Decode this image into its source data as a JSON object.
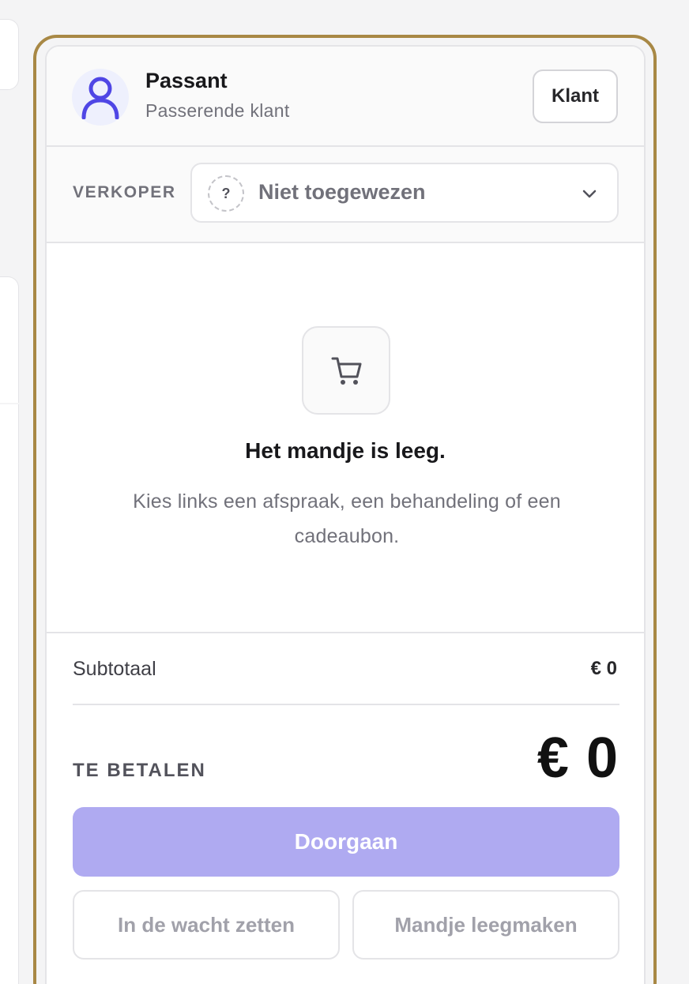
{
  "customer": {
    "name": "Passant",
    "subtitle": "Passerende klant",
    "button_label": "Klant"
  },
  "seller": {
    "label": "VERKOPER",
    "placeholder_symbol": "?",
    "value": "Niet toegewezen"
  },
  "cart": {
    "empty_title": "Het mandje is leeg.",
    "empty_text": "Kies links een afspraak, een behandeling of een cadeaubon."
  },
  "totals": {
    "subtotal_label": "Subtotaal",
    "subtotal_value": "€ 0",
    "pay_label": "TE BETALEN",
    "pay_value": "€ 0"
  },
  "actions": {
    "continue_label": "Doorgaan",
    "hold_label": "In de wacht zetten",
    "clear_label": "Mandje leegmaken"
  },
  "colors": {
    "accent_frame": "#a88845",
    "primary_disabled": "#afaaf1",
    "avatar_icon": "#4f46e5"
  },
  "icons": {
    "avatar": "user-icon",
    "seller_dropdown": "chevron-down-icon",
    "empty_cart": "shopping-cart-icon"
  }
}
